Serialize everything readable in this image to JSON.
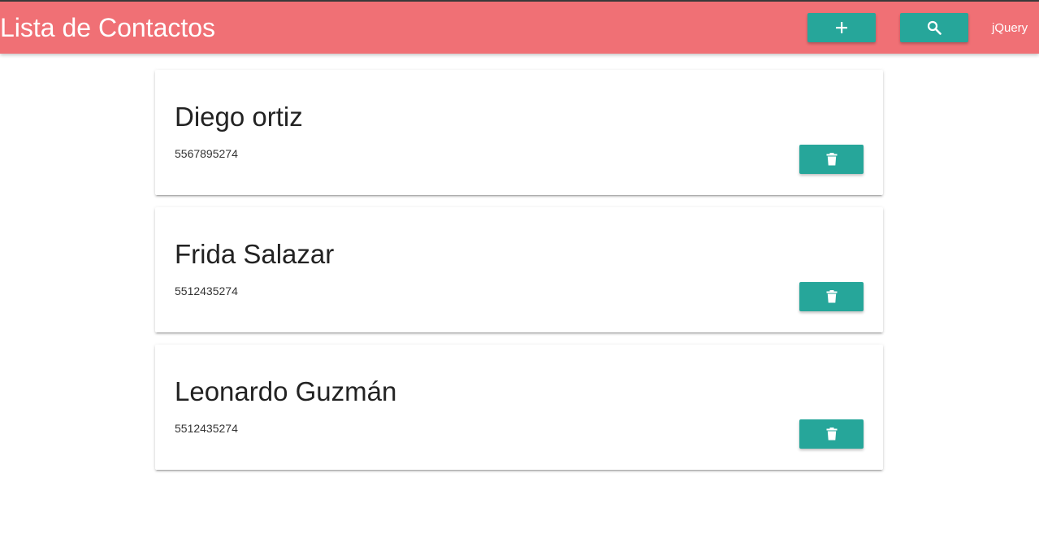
{
  "navbar": {
    "title": "Lista de Contactos",
    "add_icon": "plus-icon",
    "search_icon": "search-icon",
    "link_label": "jQuery",
    "colors": {
      "navbar_bg": "#f07075",
      "button_bg": "#26a69a"
    }
  },
  "contacts": [
    {
      "name": "Diego ortiz",
      "phone": "5567895274",
      "delete_icon": "trash-icon"
    },
    {
      "name": "Frida Salazar",
      "phone": "5512435274",
      "delete_icon": "trash-icon"
    },
    {
      "name": "Leonardo Guzmán",
      "phone": "5512435274",
      "delete_icon": "trash-icon"
    }
  ]
}
